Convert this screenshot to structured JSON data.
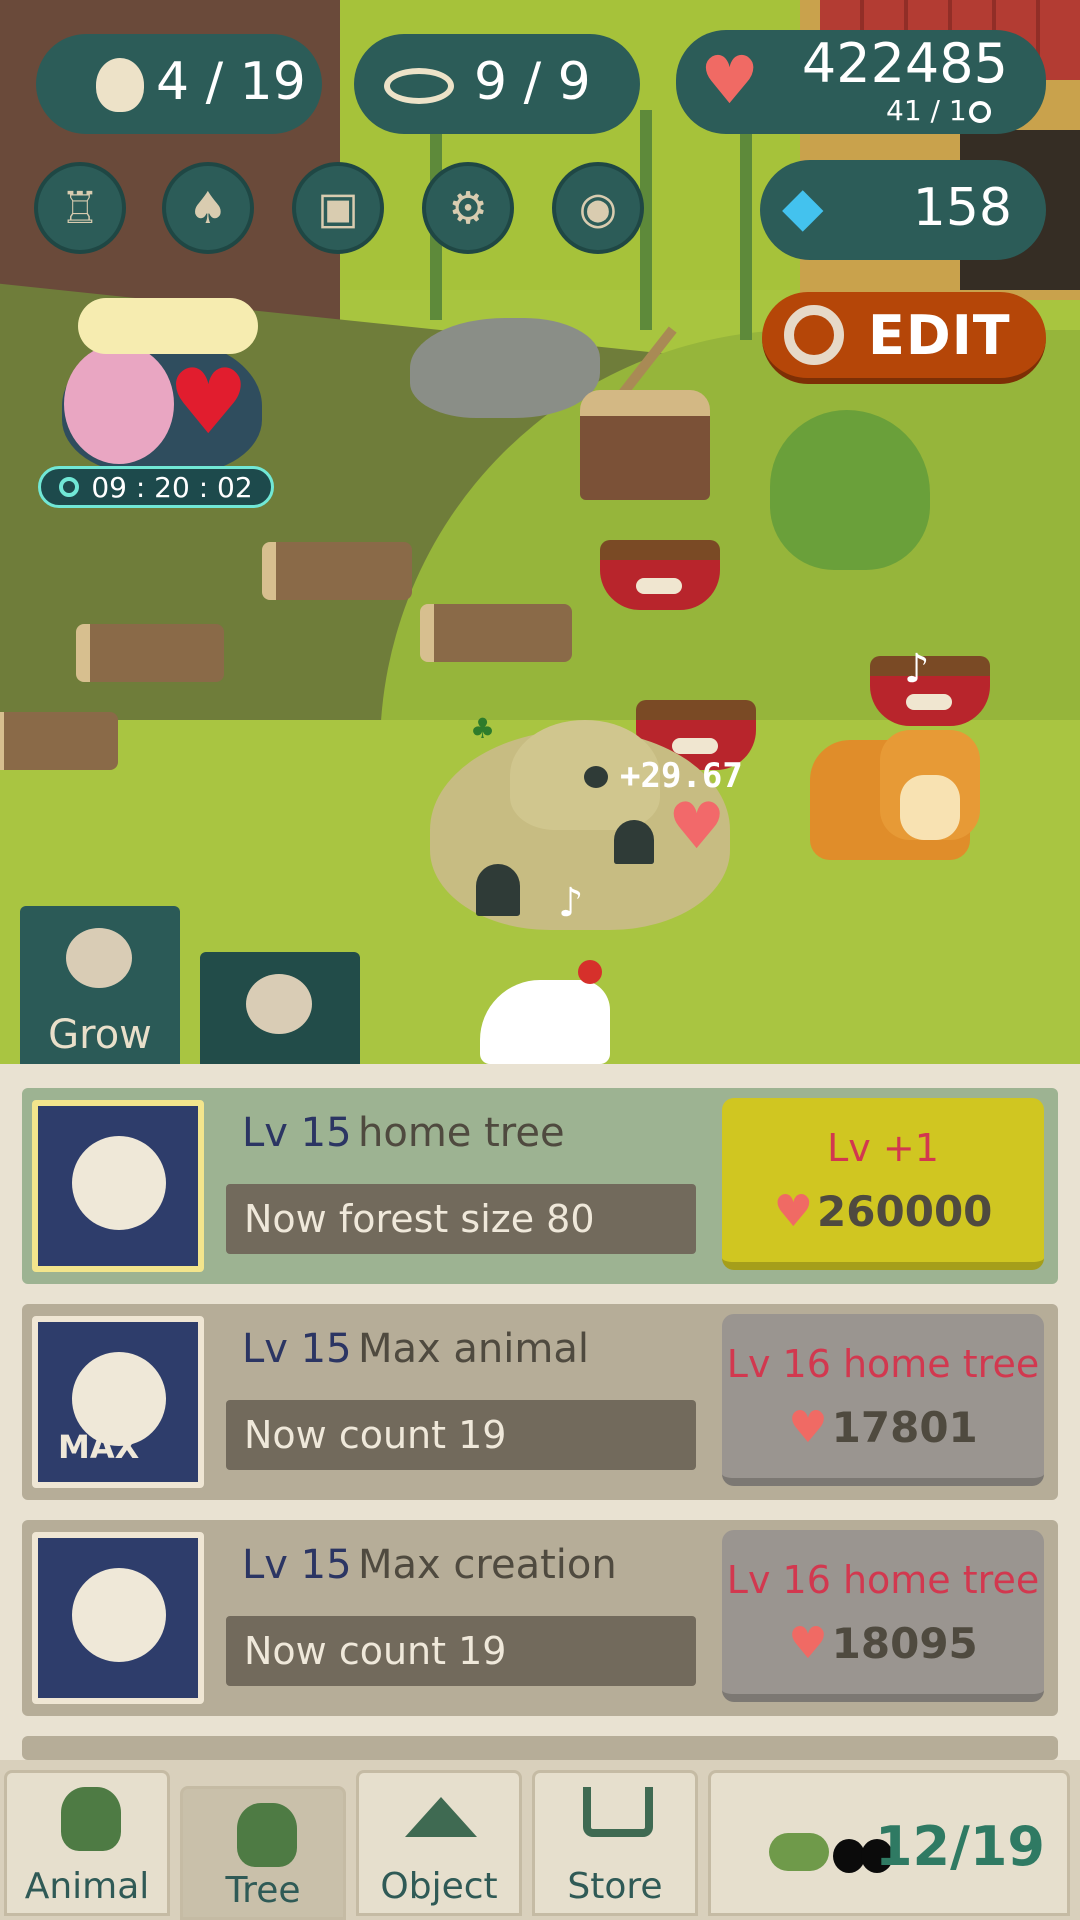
{
  "hud": {
    "animals": "4 / 19",
    "fish": "9 / 9",
    "hearts": "422485",
    "heart_rate": "41  / 1",
    "gems": "158"
  },
  "edit_label": "EDIT",
  "gift_timer": "09 : 20 : 02",
  "float_gain": "+29.67",
  "side_tabs": {
    "grow": "Grow"
  },
  "upgrades": [
    {
      "level": "Lv 15",
      "name": "home tree",
      "info": "Now forest size 80",
      "cta_title": "Lv +1",
      "cost": "260000"
    },
    {
      "level": "Lv 15",
      "name": "Max animal",
      "info": "Now count 19",
      "cta_title": "Lv 16 home tree",
      "cost": "17801"
    },
    {
      "level": "Lv 15",
      "name": "Max creation",
      "info": "Now count 19",
      "cta_title": "Lv 16 home tree",
      "cost": "18095"
    }
  ],
  "nav": {
    "animal": "Animal",
    "tree": "Tree",
    "object": "Object",
    "store": "Store",
    "collection": "12/19"
  },
  "icons": [
    "chick-icon",
    "fish-icon",
    "heart-icon",
    "gem-icon",
    "trophy-icon",
    "cards-icon",
    "box-icon",
    "gear-icon",
    "camera-icon",
    "wrench-icon",
    "timer-icon"
  ],
  "colors": {
    "hud_bg": "#2c5c58",
    "edit_bg": "#b54608",
    "cta_active": "#d0c621",
    "cta_price": "#d2384f"
  }
}
